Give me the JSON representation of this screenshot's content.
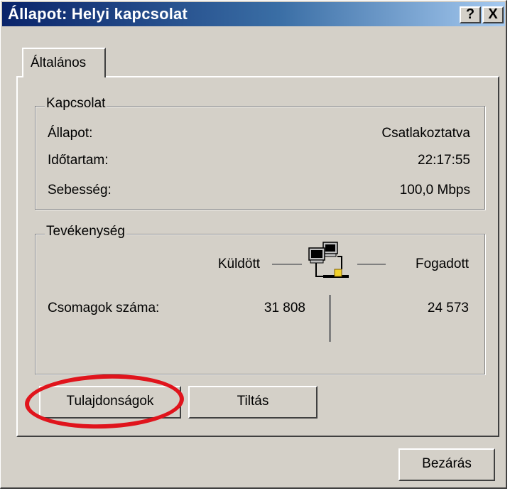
{
  "window": {
    "title": "Állapot: Helyi kapcsolat",
    "help_label": "?",
    "close_label": "X"
  },
  "tabs": [
    {
      "label": "Általános",
      "active": true
    }
  ],
  "connection": {
    "group_label": "Kapcsolat",
    "rows": [
      {
        "label": "Állapot:",
        "value": "Csatlakoztatva"
      },
      {
        "label": "Időtartam:",
        "value": "22:17:55"
      },
      {
        "label": "Sebesség:",
        "value": "100,0 Mbps"
      }
    ]
  },
  "activity": {
    "group_label": "Tevékenység",
    "sent_label": "Küldött",
    "received_label": "Fogadott",
    "packets_label": "Csomagok száma:",
    "packets_sent": "31 808",
    "packets_received": "24 573",
    "icon": "network-computers-icon"
  },
  "buttons": {
    "properties": "Tulajdonságok",
    "disable": "Tiltás",
    "close": "Bezárás"
  },
  "colors": {
    "face": "#d4d0c8",
    "titlebar_start": "#0a246a",
    "titlebar_end": "#a6caf0",
    "highlight_oval": "#e0141c"
  }
}
